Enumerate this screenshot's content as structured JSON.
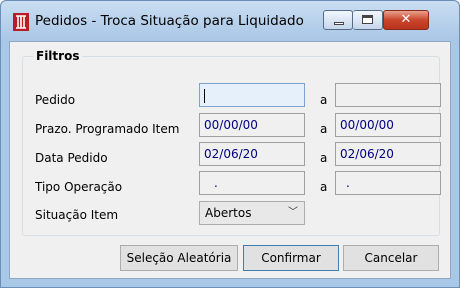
{
  "window": {
    "title": "Pedidos - Troca Situação para Liquidado"
  },
  "filters": {
    "group_label": "Filtros",
    "separator": "a",
    "rows": [
      {
        "label": "Pedido",
        "from": "",
        "to": ""
      },
      {
        "label": "Prazo. Programado Item",
        "from": "00/00/00",
        "to": "00/00/00"
      },
      {
        "label": "Data Pedido",
        "from": "02/06/20",
        "to": "02/06/20"
      },
      {
        "label": "Tipo Operação",
        "from": ".",
        "to": "."
      }
    ],
    "situacao": {
      "label": "Situação Item",
      "value": "Abertos"
    }
  },
  "buttons": {
    "random": "Seleção Aleatória",
    "confirm": "Confirmar",
    "cancel": "Cancelar"
  },
  "colors": {
    "title_bg": "#a9c6e6",
    "client_bg": "#f0f0f0",
    "field_text": "#000080",
    "close_btn": "#c9452b"
  }
}
